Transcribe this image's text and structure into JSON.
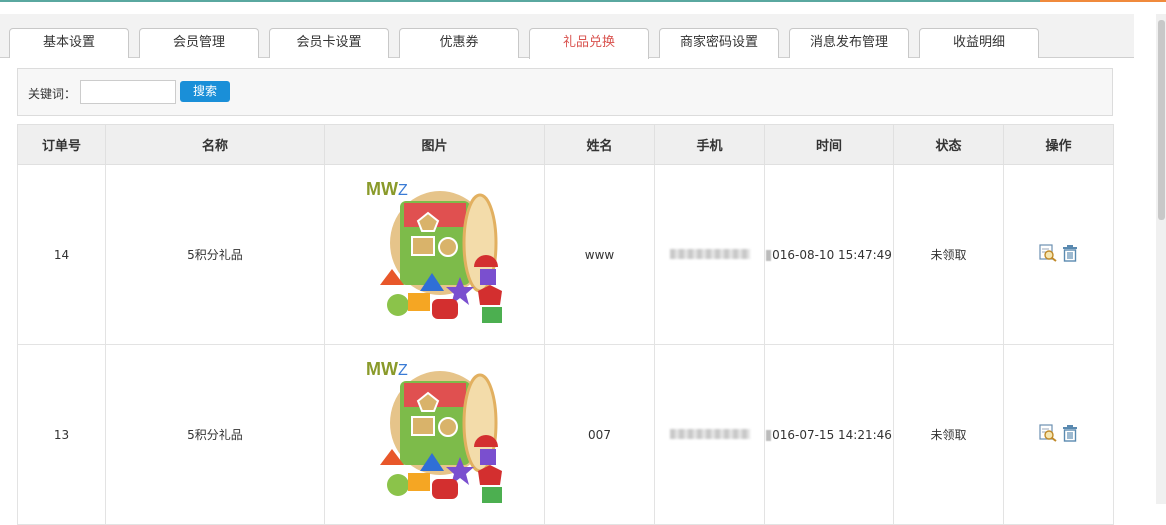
{
  "tabs": [
    {
      "label": "基本设置",
      "active": false
    },
    {
      "label": "会员管理",
      "active": false
    },
    {
      "label": "会员卡设置",
      "active": false
    },
    {
      "label": "优惠券",
      "active": false
    },
    {
      "label": "礼品兑换",
      "active": true
    },
    {
      "label": "商家密码设置",
      "active": false
    },
    {
      "label": "消息发布管理",
      "active": false
    },
    {
      "label": "收益明细",
      "active": false
    }
  ],
  "search": {
    "label": "关键词：",
    "value": "",
    "button": "搜索"
  },
  "table": {
    "headers": [
      "订单号",
      "名称",
      "图片",
      "姓名",
      "手机",
      "时间",
      "状态",
      "操作"
    ],
    "rows": [
      {
        "order": "14",
        "name": "5积分礼品",
        "user": "www",
        "phone": "",
        "time": "016-08-10 15:47:49",
        "status": "未领取"
      },
      {
        "order": "13",
        "name": "5积分礼品",
        "user": "007",
        "phone": "",
        "time": "016-07-15 14:21:46",
        "status": "未领取"
      }
    ]
  },
  "icons": {
    "view": "view-magnifier-icon",
    "delete": "trash-icon",
    "accent": "#d9534f",
    "button_color": "#1a8fd8"
  }
}
